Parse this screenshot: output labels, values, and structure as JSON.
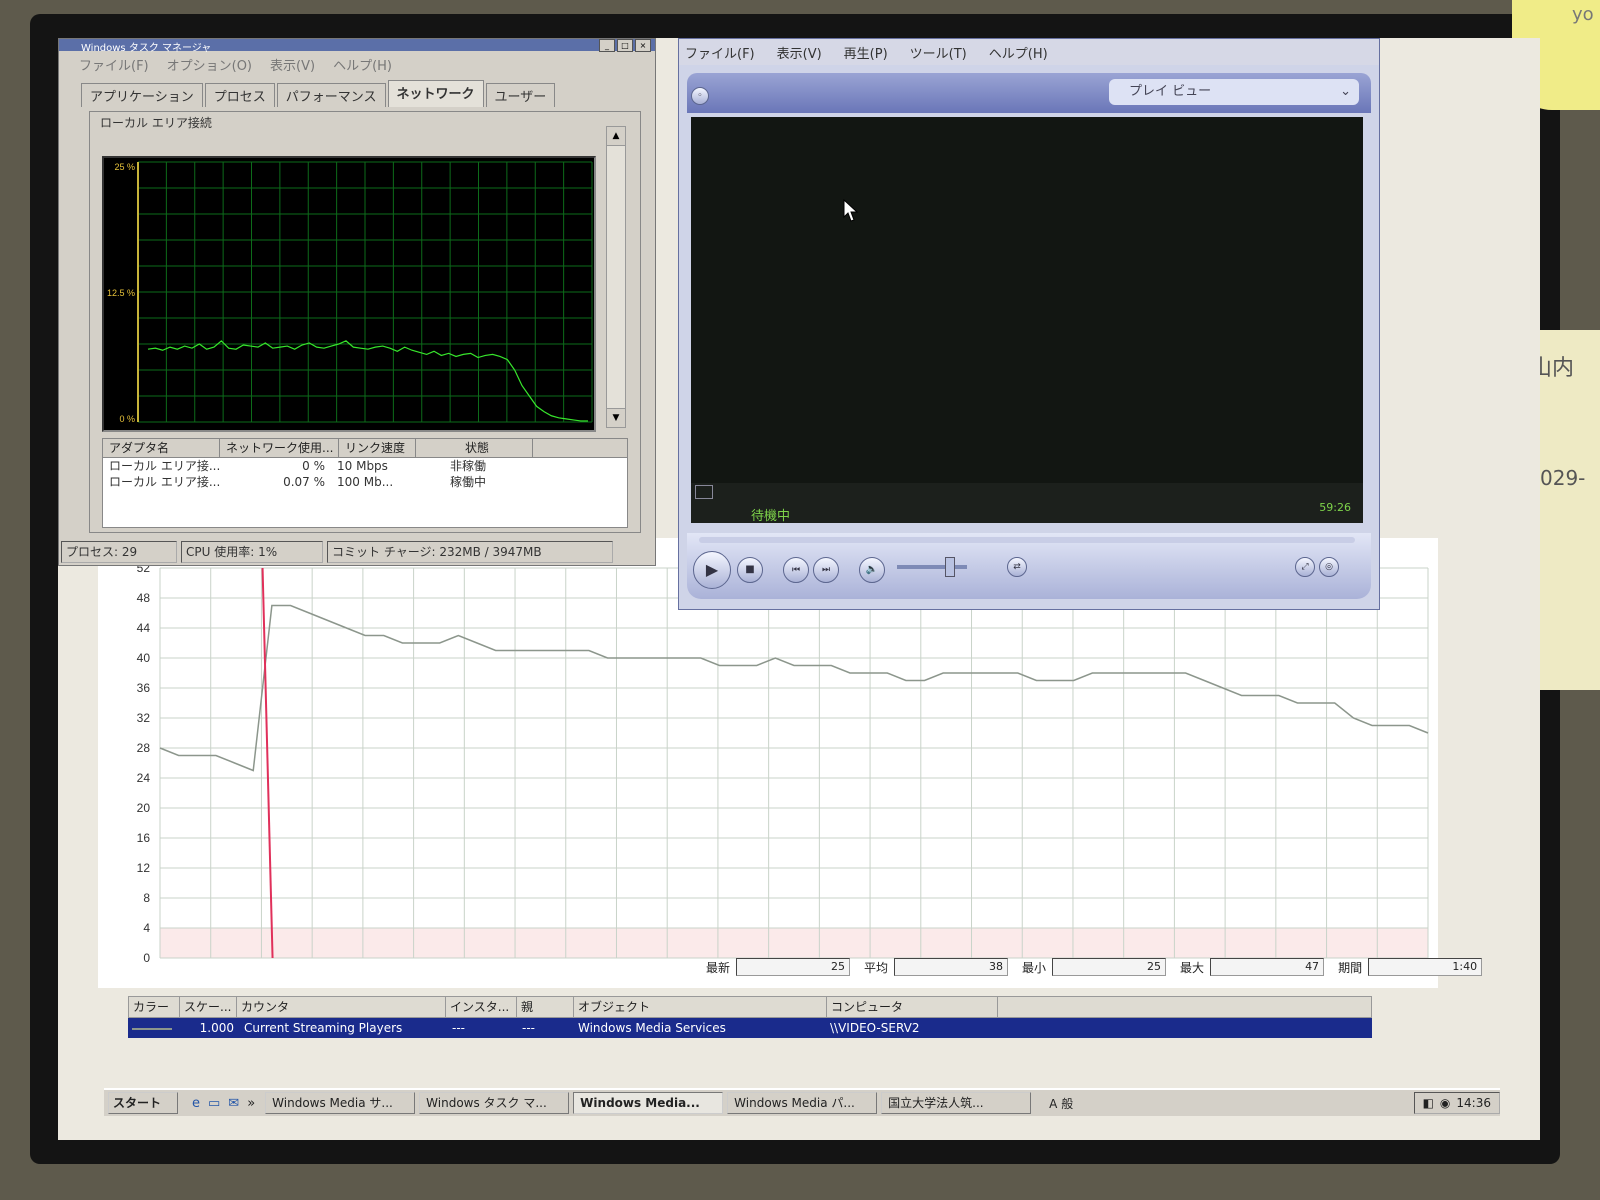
{
  "note_top": "yo",
  "note_side": {
    "line1": "山内",
    "line2": "029-"
  },
  "task_manager": {
    "title": "Windows タスク マネージャ",
    "menu": [
      "ファイル(F)",
      "オプション(O)",
      "表示(V)",
      "ヘルプ(H)"
    ],
    "tabs": [
      "アプリケーション",
      "プロセス",
      "パフォーマンス",
      "ネットワーク",
      "ユーザー"
    ],
    "active_tab": "ネットワーク",
    "group_label": "ローカル エリア接続",
    "y_labels": [
      "25 %",
      "12.5 %",
      "0 %"
    ],
    "adapter_headers": [
      "アダプタ名",
      "ネットワーク使用...",
      "リンク速度",
      "状態"
    ],
    "adapters": [
      {
        "name": "ローカル エリア接...",
        "usage": "0 %",
        "speed": "10 Mbps",
        "state": "非稼働"
      },
      {
        "name": "ローカル エリア接...",
        "usage": "0.07 %",
        "speed": "100 Mb...",
        "state": "稼働中"
      }
    ],
    "status": {
      "processes": "プロセス: 29",
      "cpu": "CPU 使用率: 1%",
      "commit": "コミット チャージ: 232MB / 3947MB"
    },
    "line_color": "#37e62c",
    "net_usage_pct": [
      7.0,
      7.1,
      6.9,
      7.2,
      7.0,
      7.3,
      7.1,
      7.5,
      7.0,
      7.2,
      7.8,
      7.1,
      7.0,
      7.4,
      7.3,
      7.2,
      7.6,
      7.1,
      7.2,
      7.3,
      7.0,
      7.4,
      7.6,
      7.2,
      7.1,
      7.3,
      7.5,
      7.8,
      7.2,
      7.1,
      7.0,
      7.2,
      7.3,
      7.1,
      6.8,
      7.2,
      6.9,
      6.7,
      6.5,
      6.8,
      6.4,
      6.6,
      6.3,
      6.5,
      6.6,
      6.2,
      6.4,
      6.5,
      6.3,
      6.0,
      5.0,
      3.5,
      2.5,
      1.5,
      1.0,
      0.6,
      0.4,
      0.3,
      0.2,
      0.1,
      0.1
    ]
  },
  "media_player": {
    "menu": [
      "ファイル(F)",
      "表示(V)",
      "再生(P)",
      "ツール(T)",
      "ヘルプ(H)"
    ],
    "view_select": "プレイ ビュー",
    "status": "待機中",
    "time": "59:26"
  },
  "perf_chart": {
    "y_ticks": [
      "52",
      "48",
      "44",
      "40",
      "36",
      "32",
      "28",
      "24",
      "20",
      "16",
      "12",
      "8",
      "4",
      "0"
    ],
    "line_color": "#8c968c",
    "marker_color": "#e0305a",
    "stats": [
      {
        "label": "最新",
        "value": "25"
      },
      {
        "label": "平均",
        "value": "38"
      },
      {
        "label": "最小",
        "value": "25"
      },
      {
        "label": "最大",
        "value": "47"
      },
      {
        "label": "期間",
        "value": "1:40"
      }
    ],
    "counter_headers": [
      "カラー",
      "スケー...",
      "カウンタ",
      "インスタ...",
      "親",
      "オブジェクト",
      "コンピュータ"
    ],
    "counter_row": {
      "scale": "1.000",
      "counter": "Current Streaming Players",
      "instance": "---",
      "parent": "---",
      "object": "Windows Media Services",
      "computer": "\\\\VIDEO-SERV2"
    }
  },
  "chart_data": {
    "type": "line",
    "title": "",
    "xlabel": "",
    "ylabel": "",
    "ylim": [
      0,
      52
    ],
    "series": [
      {
        "name": "Current Streaming Players",
        "values": [
          28,
          27,
          27,
          27,
          26,
          25,
          47,
          47,
          46,
          45,
          44,
          43,
          43,
          42,
          42,
          42,
          43,
          42,
          41,
          41,
          41,
          41,
          41,
          41,
          40,
          40,
          40,
          40,
          40,
          40,
          39,
          39,
          39,
          40,
          39,
          39,
          39,
          38,
          38,
          38,
          37,
          37,
          38,
          38,
          38,
          38,
          38,
          37,
          37,
          37,
          38,
          38,
          38,
          38,
          38,
          38,
          37,
          36,
          35,
          35,
          35,
          34,
          34,
          34,
          32,
          31,
          31,
          31,
          30
        ]
      }
    ]
  },
  "taskbar": {
    "start": "スタート",
    "tasks": [
      "Windows Media サ...",
      "Windows タスク マ...",
      "Windows Media...",
      "Windows Media パ...",
      "国立大学法人筑..."
    ],
    "active_task": 2,
    "ime": "A 般",
    "clock": "14:36"
  }
}
